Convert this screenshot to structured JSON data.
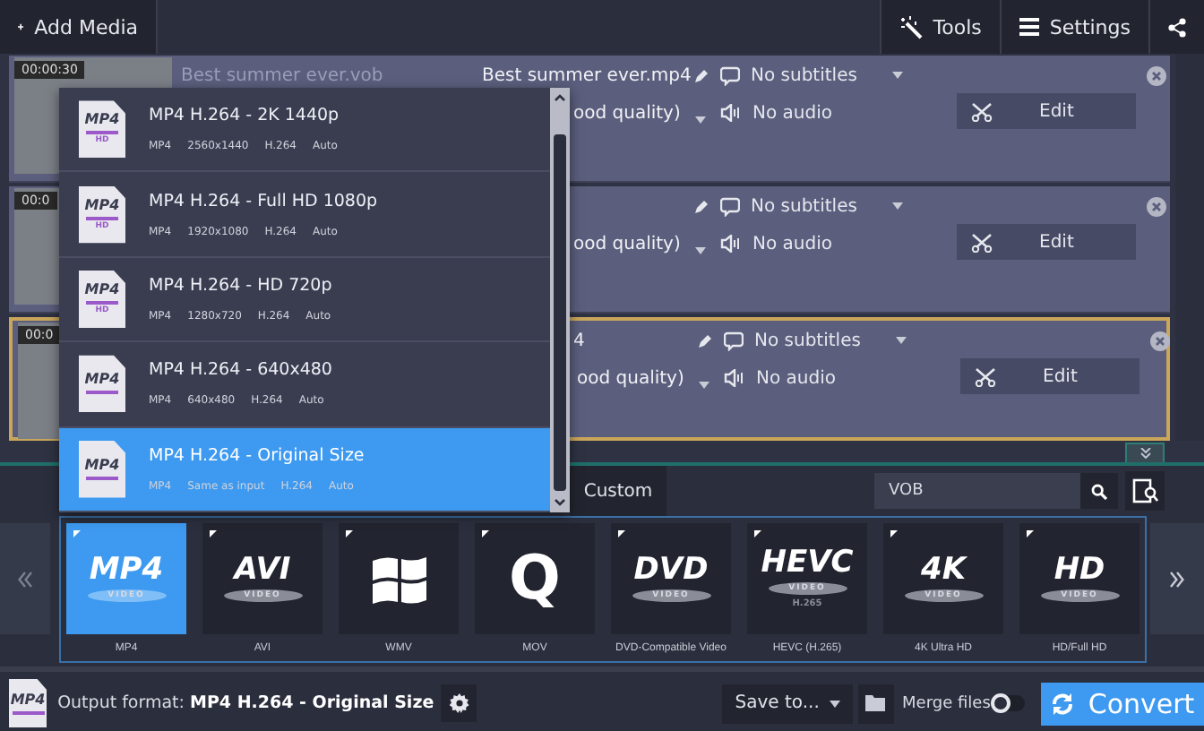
{
  "toolbar": {
    "add_media": "Add Media",
    "tools": "Tools",
    "settings": "Settings"
  },
  "media": [
    {
      "time": "00:00:30",
      "source": "Best summer ever.vob",
      "output": "Best summer ever.mp4",
      "quality": "ood quality)",
      "subtitles": "No subtitles",
      "audio": "No audio",
      "edit": "Edit",
      "selected": false
    },
    {
      "time": "00:0",
      "quality": "ood quality)",
      "subtitles": "No subtitles",
      "audio": "No audio",
      "edit": "Edit",
      "selected": false
    },
    {
      "time": "00:0",
      "output": "4",
      "quality": "ood quality)",
      "subtitles": "No subtitles",
      "audio": "No audio",
      "edit": "Edit",
      "selected": true
    }
  ],
  "preset_menu": [
    {
      "icon_text": "MP4",
      "icon_badge": "HD",
      "title": "MP4 H.264 - 2K 1440p",
      "specs": [
        "MP4",
        "2560x1440",
        "H.264",
        "Auto"
      ],
      "selected": false
    },
    {
      "icon_text": "MP4",
      "icon_badge": "HD",
      "title": "MP4 H.264 - Full HD 1080p",
      "specs": [
        "MP4",
        "1920x1080",
        "H.264",
        "Auto"
      ],
      "selected": false
    },
    {
      "icon_text": "MP4",
      "icon_badge": "HD",
      "title": "MP4 H.264 - HD 720p",
      "specs": [
        "MP4",
        "1280x720",
        "H.264",
        "Auto"
      ],
      "selected": false
    },
    {
      "icon_text": "MP4",
      "title": "MP4 H.264 - 640x480",
      "specs": [
        "MP4",
        "640x480",
        "H.264",
        "Auto"
      ],
      "selected": false
    },
    {
      "icon_text": "MP4",
      "title": "MP4 H.264 - Original Size",
      "specs": [
        "MP4",
        "Same as input",
        "H.264",
        "Auto"
      ],
      "selected": true
    }
  ],
  "custom_tab": "Custom",
  "search": {
    "value": "VOB"
  },
  "formats": [
    {
      "kind": "wordmark",
      "logo": "MP4",
      "sub": "VIDEO",
      "label": "MP4",
      "selected": true
    },
    {
      "kind": "wordmark",
      "logo": "AVI",
      "sub": "VIDEO",
      "label": "AVI",
      "selected": false
    },
    {
      "kind": "windows",
      "label": "WMV",
      "selected": false
    },
    {
      "kind": "letter",
      "logo": "Q",
      "label": "MOV",
      "selected": false
    },
    {
      "kind": "wordmark",
      "logo": "DVD",
      "sub": "VIDEO",
      "label": "DVD-Compatible Video",
      "selected": false
    },
    {
      "kind": "wordmark",
      "logo": "HEVC",
      "sub": "VIDEO",
      "extra": "H.265",
      "label": "HEVC (H.265)",
      "selected": false
    },
    {
      "kind": "wordmark",
      "logo": "4K",
      "sub": "VIDEO",
      "label": "4K Ultra HD",
      "selected": false
    },
    {
      "kind": "wordmark",
      "logo": "HD",
      "sub": "VIDEO",
      "label": "HD/Full HD",
      "selected": false
    }
  ],
  "output": {
    "icon_text": "MP4",
    "text": "Output format: **MP4 H.264 - Original Size**"
  },
  "save_to": "Save to...",
  "merge": {
    "label": "Merge files",
    "on": false
  },
  "convert": "Convert"
}
